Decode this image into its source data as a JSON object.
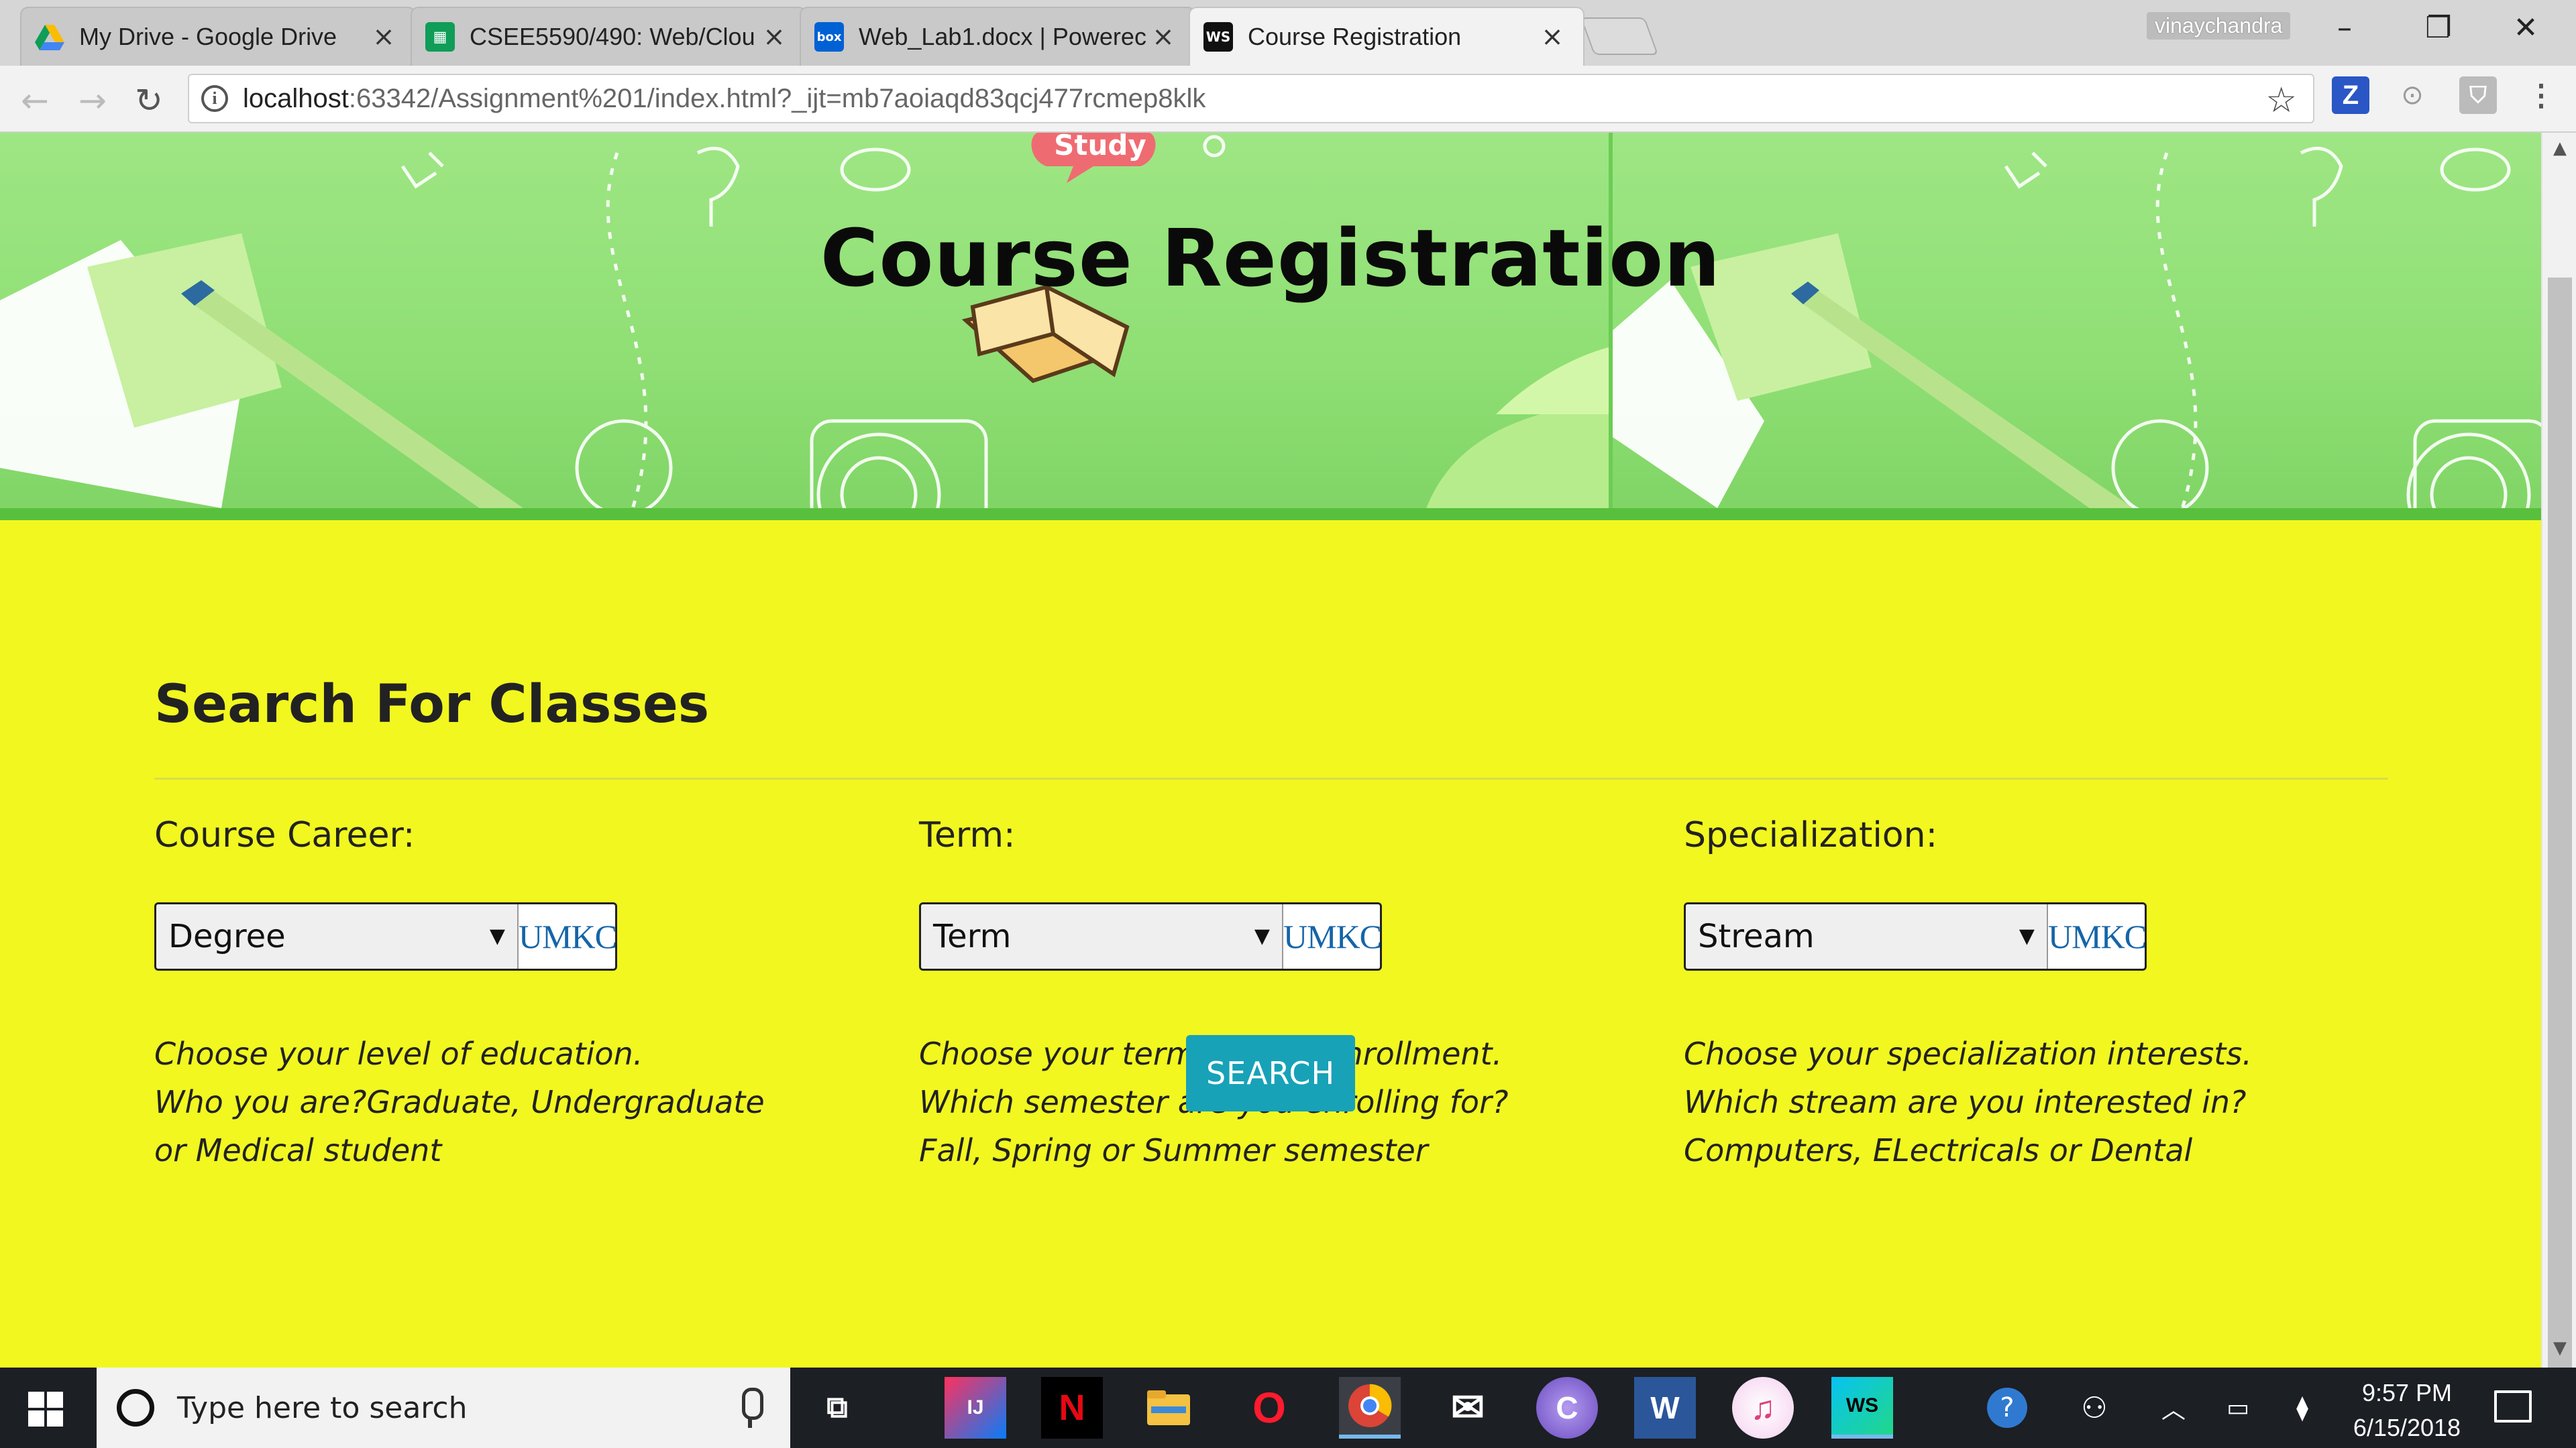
{
  "browser": {
    "tabs": [
      {
        "label": "My Drive - Google Drive",
        "icon": "google-drive-icon"
      },
      {
        "label": "CSEE5590/490: Web/Clou",
        "icon": "google-sheets-icon"
      },
      {
        "label": "Web_Lab1.docx | Powerec",
        "icon": "box-icon"
      },
      {
        "label": "Course Registration",
        "icon": "webstorm-icon",
        "active": true
      }
    ],
    "profile_name": "vinaychandra",
    "url_host": "localhost",
    "url_rest": ":63342/Assignment%201/index.html?_ijt=mb7aoiaqd83qcj477rcmep8klk",
    "extensions": [
      "Z",
      "⊙",
      "⛉"
    ]
  },
  "page": {
    "hero_title": "Course Registration",
    "hero_sticker_text": "Study",
    "section_title": "Search For Classes",
    "columns": [
      {
        "label": "Course Career:",
        "select_value": "Degree",
        "logo": "UMKC",
        "help": [
          "Choose your level of education.",
          "Who you are?Graduate, Undergraduate",
          "or Medical student"
        ]
      },
      {
        "label": "Term:",
        "select_value": "Term",
        "logo": "UMKC",
        "help": [
          "Choose your term of your enrollment.",
          "Which semester are you enrolling for?",
          "Fall, Spring or Summer semester"
        ]
      },
      {
        "label": "Specialization:",
        "select_value": "Stream",
        "logo": "UMKC",
        "help": [
          "Choose your specialization interests.",
          "Which stream are you interested in?",
          "Computers, ELectricals or Dental"
        ]
      }
    ],
    "search_button": "SEARCH",
    "colors": {
      "page_bg": "#f2f720",
      "button": "#17a2b8",
      "hero": "#8fdf74"
    }
  },
  "taskbar": {
    "search_placeholder": "Type here to search",
    "apps": [
      {
        "name": "intellij-icon",
        "glyph": "IJ"
      },
      {
        "name": "netflix-icon",
        "glyph": "N"
      },
      {
        "name": "file-explorer-icon",
        "glyph": ""
      },
      {
        "name": "opera-icon",
        "glyph": "O"
      },
      {
        "name": "chrome-icon",
        "glyph": ""
      },
      {
        "name": "mail-icon",
        "glyph": "✉"
      },
      {
        "name": "app-icon",
        "glyph": "C"
      },
      {
        "name": "word-icon",
        "glyph": "W"
      },
      {
        "name": "itunes-icon",
        "glyph": "♫"
      },
      {
        "name": "webstorm-icon",
        "glyph": "WS"
      }
    ],
    "clock_time": "9:57 PM",
    "clock_date": "6/15/2018"
  }
}
